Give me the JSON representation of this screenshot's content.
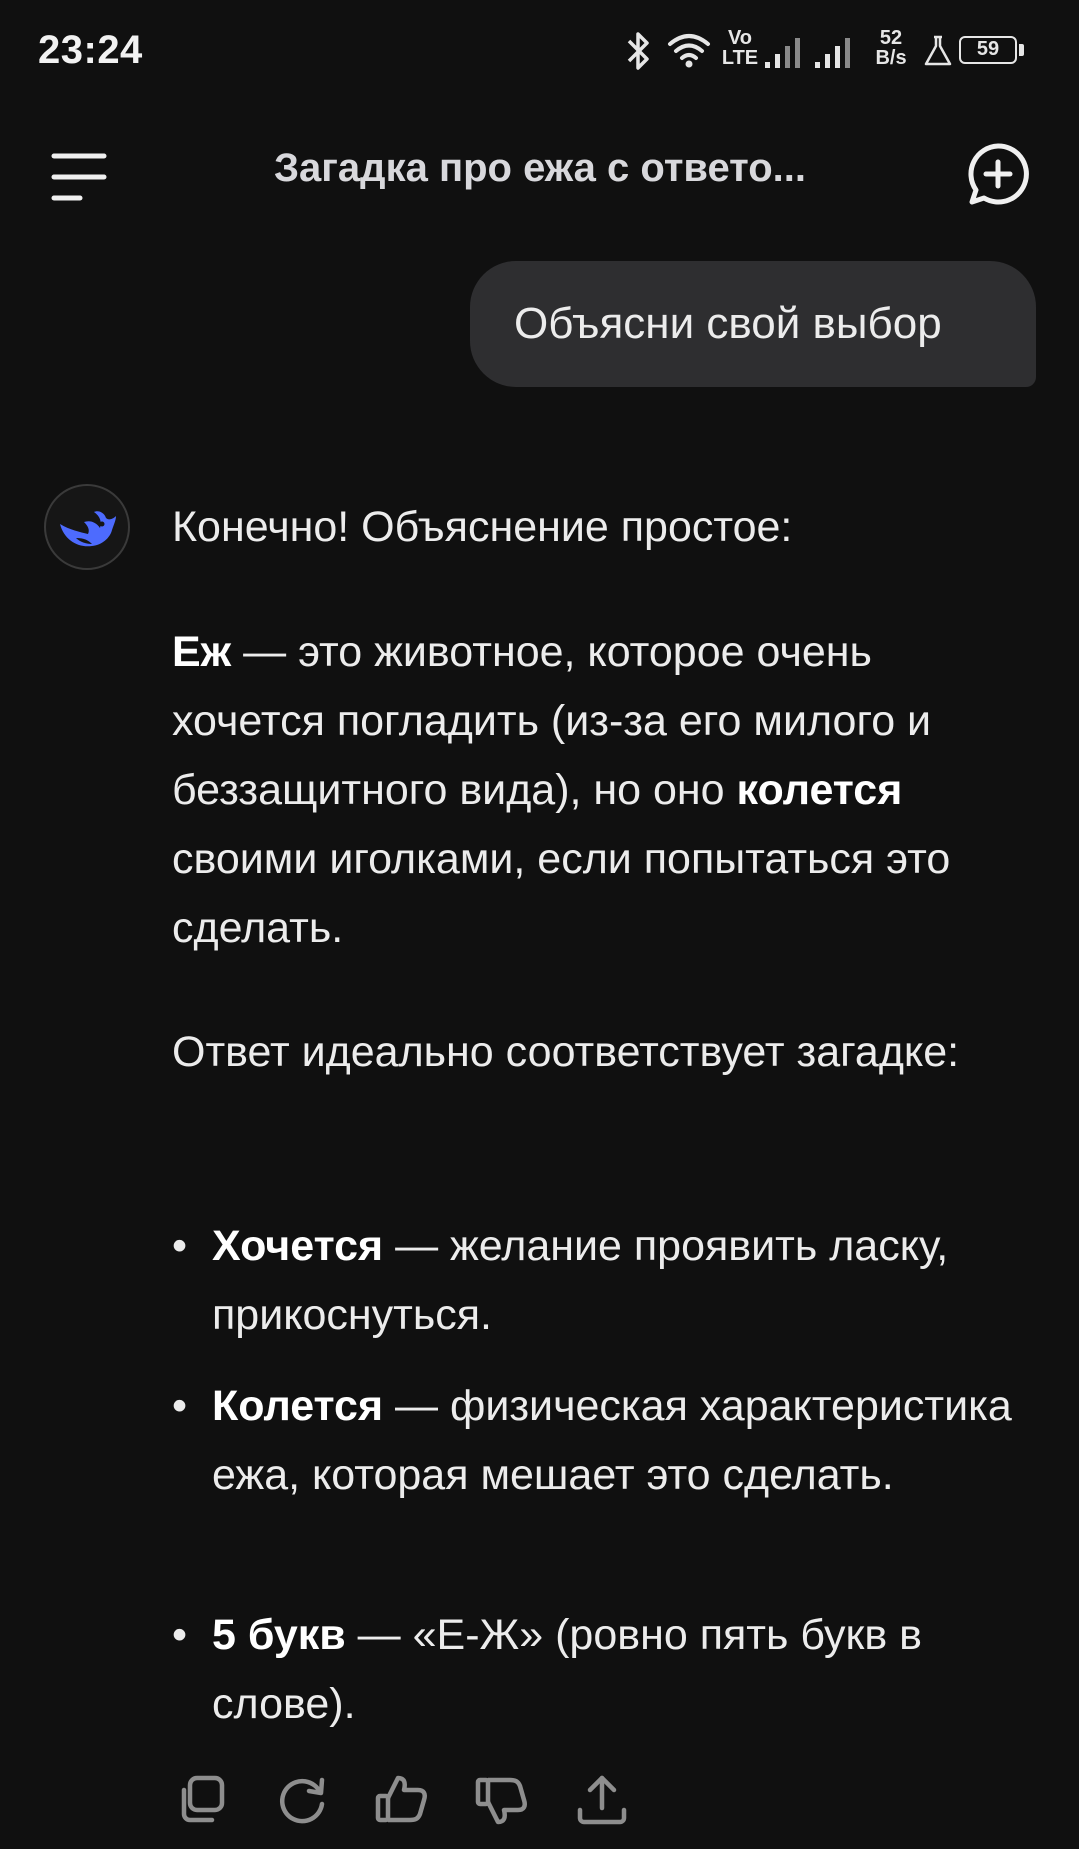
{
  "status_bar": {
    "time": "23:24",
    "net_type_top": "Vo",
    "net_type_bottom": "LTE",
    "speed_value": "52",
    "speed_unit": "B/s",
    "battery": "59",
    "icons": [
      "bluetooth-icon",
      "wifi-icon",
      "signal-icon",
      "signal-icon",
      "alert-icon",
      "battery-icon"
    ]
  },
  "header": {
    "title": "Загадка про ежа с ответо...",
    "menu_icon": "menu-icon",
    "new_chat_icon": "new-chat-icon"
  },
  "user_message": {
    "text": "Объясни свой выбор"
  },
  "assistant": {
    "avatar_icon": "whale-logo-icon",
    "intro": "Конечно! Объяснение простое:",
    "p2_bold1": "Еж",
    "p2_text1": " — это животное, которое очень хочется погладить (из-за его милого и беззащитного вида), но оно ",
    "p2_bold2": "колется",
    "p2_text2": " своими иголками, если попытаться это сделать.",
    "p3": "Ответ идеально соответствует загадке:",
    "bullets": [
      {
        "term": "Хочется",
        "text": " — желание проявить ласку, прикоснуться."
      },
      {
        "term": "Колется",
        "text": " — физическая характеристика ежа, которая мешает это сделать."
      },
      {
        "term": "5 букв",
        "text": " — «Е-Ж» (ровно пять букв в слове)."
      }
    ]
  },
  "actions": [
    "copy-icon",
    "regenerate-icon",
    "thumbs-up-icon",
    "thumbs-down-icon",
    "share-icon"
  ],
  "colors": {
    "background": "#101010",
    "user_bubble": "#2e2e30",
    "brand_blue": "#4d6bfe",
    "text": "#ececec"
  }
}
